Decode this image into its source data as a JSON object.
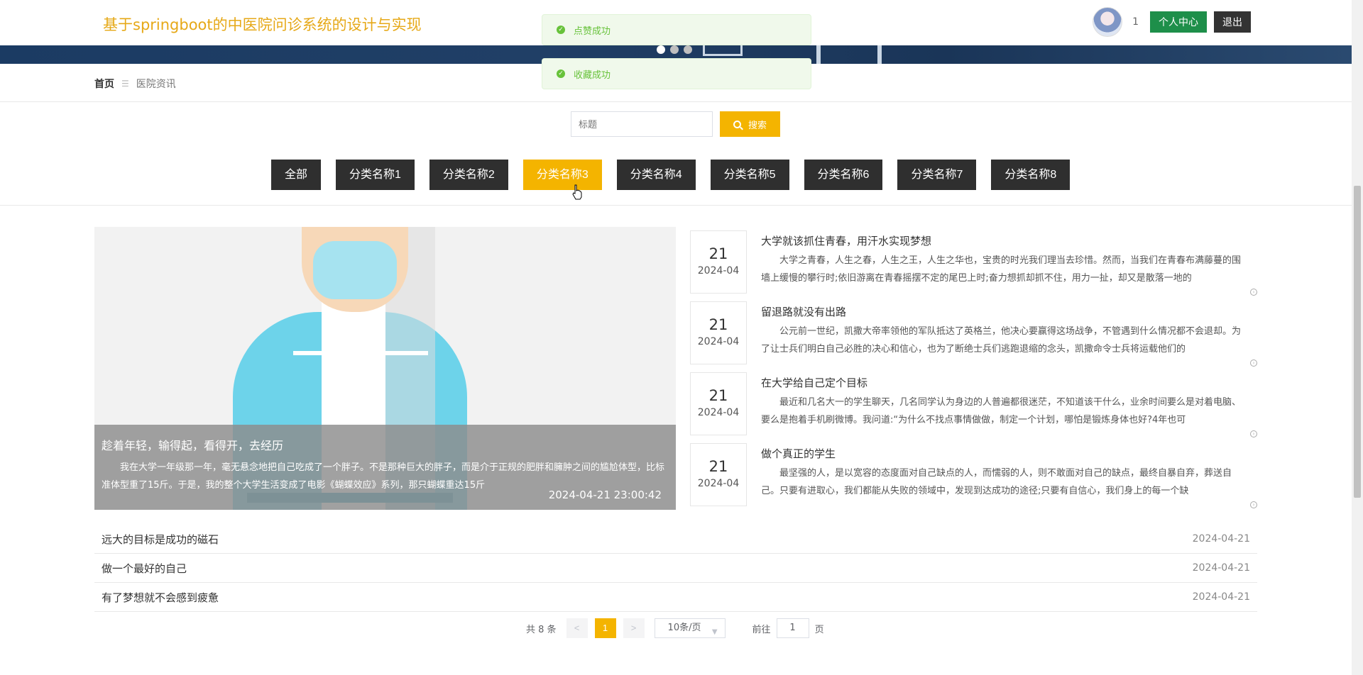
{
  "header": {
    "site_title": "基于springboot的中医院问诊系统的设计与实现",
    "user_count": "1",
    "profile_button": "个人中心",
    "logout_button": "退出"
  },
  "toasts": [
    {
      "text": "点赞成功"
    },
    {
      "text": "收藏成功"
    }
  ],
  "breadcrumb": {
    "home": "首页",
    "separator": "☰",
    "current": "医院资讯"
  },
  "search": {
    "placeholder": "标题",
    "button_label": "搜索"
  },
  "categories": [
    "全部",
    "分类名称1",
    "分类名称2",
    "分类名称3",
    "分类名称4",
    "分类名称5",
    "分类名称6",
    "分类名称7",
    "分类名称8"
  ],
  "active_category": "分类名称3",
  "featured": {
    "title": "趁着年轻，输得起，看得开，去经历",
    "text": "我在大学一年级那一年，毫无悬念地把自己吃成了一个胖子。不是那种巨大的胖子，而是介于正规的肥胖和臃肿之间的尴尬体型，比标准体型重了15斤。于是，我的整个大学生活变成了电影《蝴蝶效应》系列，那只蝴蝶重达15斤",
    "time": "2024-04-21 23:00:42"
  },
  "news": [
    {
      "day": "21",
      "ym": "2024-04",
      "title": "大学就该抓住青春，用汗水实现梦想",
      "text": "大学之青春，人生之春，人生之王，人生之华也，宝贵的时光我们理当去珍惜。然而，当我们在青春布满藤蔓的围墙上缓慢的攀行时;依旧游离在青春摇摆不定的尾巴上时;奋力想抓却抓不住，用力一扯，却又是散落一地的"
    },
    {
      "day": "21",
      "ym": "2024-04",
      "title": "留退路就没有出路",
      "text": "公元前一世纪，凯撒大帝率领他的军队抵达了英格兰，他决心要赢得这场战争，不管遇到什么情况都不会退却。为了让士兵们明白自己必胜的决心和信心，也为了断绝士兵们逃跑退缩的念头，凯撒命令士兵将运载他们的"
    },
    {
      "day": "21",
      "ym": "2024-04",
      "title": "在大学给自己定个目标",
      "text": "最近和几名大一的学生聊天，几名同学认为身边的人普遍都很迷茫，不知道该干什么，业余时间要么是对着电脑、要么是抱着手机刷微博。我问道:“为什么不找点事情做做，制定一个计划，哪怕是锻炼身体也好?4年也可"
    },
    {
      "day": "21",
      "ym": "2024-04",
      "title": "做个真正的学生",
      "text": "最坚强的人，是以宽容的态度面对自己缺点的人，而懦弱的人，则不敢面对自己的缺点，最终自暴自弃，葬送自己。只要有进取心，我们都能从失败的领域中，发现到达成功的途径;只要有自信心，我们身上的每一个缺"
    }
  ],
  "list": [
    {
      "title": "远大的目标是成功的磁石",
      "date": "2024-04-21"
    },
    {
      "title": "做一个最好的自己",
      "date": "2024-04-21"
    },
    {
      "title": "有了梦想就不会感到疲惫",
      "date": "2024-04-21"
    }
  ],
  "pagination": {
    "total": "共 8 条",
    "prev": "<",
    "current_page": "1",
    "next": ">",
    "page_size": "10条/页",
    "goto_label": "前往",
    "goto_value": "1",
    "page_unit": "页"
  },
  "colors": {
    "accent": "#f4b400",
    "title": "#e6a817",
    "success": "#67c23a",
    "profile_button": "#1e8f4a",
    "dark_button": "#2f2f2f"
  }
}
